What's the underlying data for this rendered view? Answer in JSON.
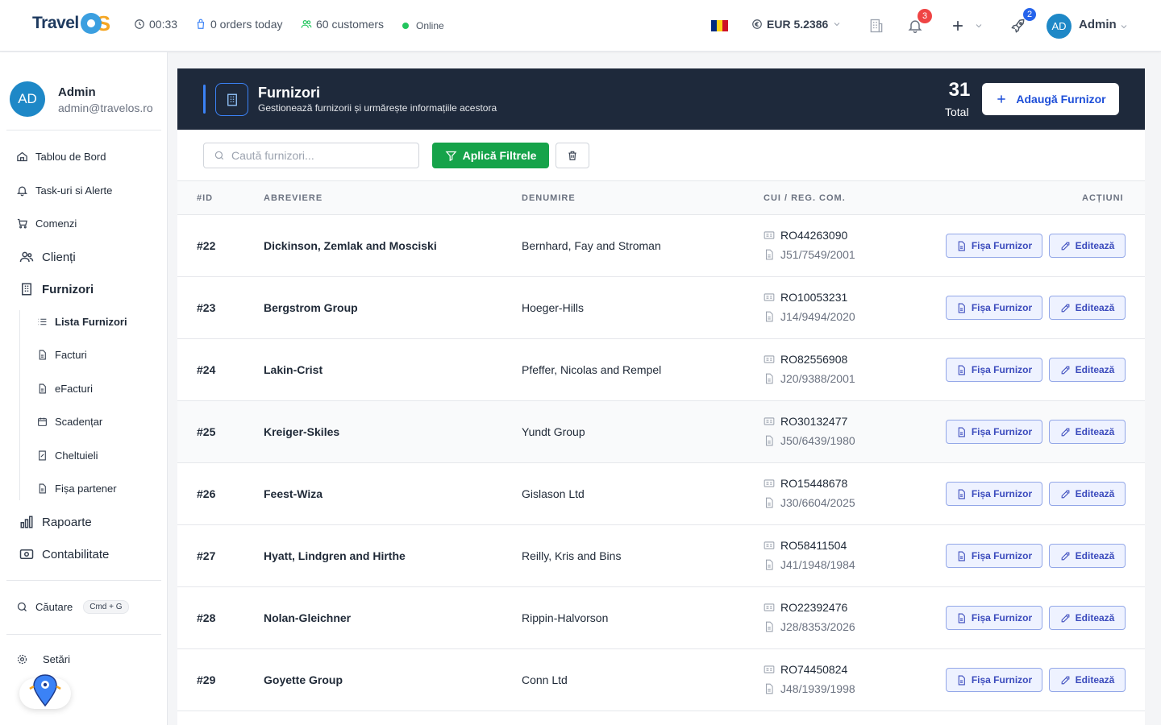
{
  "topbar": {
    "logo_text": "Travel",
    "logo_os": "OS",
    "timer": "00:33",
    "orders": "0 orders today",
    "customers": "60 customers",
    "status": "Online",
    "currency": "EUR 5.2386",
    "notifications_count": "3",
    "rocket_count": "2",
    "avatar_initials": "AD",
    "user_name": "Admin"
  },
  "sidebar": {
    "user": {
      "initials": "AD",
      "name": "Admin",
      "email": "admin@travelos.ro"
    },
    "items": [
      {
        "label": "Tablou de Bord",
        "icon": "home-icon"
      },
      {
        "label": "Task-uri si Alerte",
        "icon": "bell-icon"
      },
      {
        "label": "Comenzi",
        "icon": "cart-icon"
      },
      {
        "label": "Clienți",
        "icon": "users-icon"
      },
      {
        "label": "Furnizori",
        "icon": "building-icon"
      },
      {
        "label": "Rapoarte",
        "icon": "chart-icon"
      },
      {
        "label": "Contabilitate",
        "icon": "money-icon"
      }
    ],
    "subitems": [
      {
        "label": "Lista Furnizori",
        "icon": "list-icon"
      },
      {
        "label": "Facturi",
        "icon": "file-icon"
      },
      {
        "label": "eFacturi",
        "icon": "file-icon"
      },
      {
        "label": "Scadențar",
        "icon": "calendar-icon"
      },
      {
        "label": "Cheltuieli",
        "icon": "receipt-icon"
      },
      {
        "label": "Fișa partener",
        "icon": "file-icon"
      }
    ],
    "search_label": "Căutare",
    "search_shortcut": "Cmd + G",
    "settings_label": "Setări"
  },
  "header": {
    "title": "Furnizori",
    "subtitle": "Gestionează furnizorii și urmărește informațiile acestora",
    "total_count": "31",
    "total_label": "Total",
    "add_button": "Adaugă Furnizor"
  },
  "filters": {
    "search_placeholder": "Caută furnizori...",
    "apply_label": "Aplică Filtrele"
  },
  "table": {
    "columns": [
      "#ID",
      "ABREVIERE",
      "DENUMIRE",
      "CUI / REG. COM.",
      "ACȚIUNI"
    ],
    "fisa_label": "Fișa Furnizor",
    "edit_label": "Editează",
    "rows": [
      {
        "id": "#22",
        "abr": "Dickinson, Zemlak and Mosciski",
        "den": "Bernhard, Fay and Stroman",
        "cui": "RO44263090",
        "reg": "J51/7549/2001"
      },
      {
        "id": "#23",
        "abr": "Bergstrom Group",
        "den": "Hoeger-Hills",
        "cui": "RO10053231",
        "reg": "J14/9494/2020"
      },
      {
        "id": "#24",
        "abr": "Lakin-Crist",
        "den": "Pfeffer, Nicolas and Rempel",
        "cui": "RO82556908",
        "reg": "J20/9388/2001"
      },
      {
        "id": "#25",
        "abr": "Kreiger-Skiles",
        "den": "Yundt Group",
        "cui": "RO30132477",
        "reg": "J50/6439/1980"
      },
      {
        "id": "#26",
        "abr": "Feest-Wiza",
        "den": "Gislason Ltd",
        "cui": "RO15448678",
        "reg": "J30/6604/2025"
      },
      {
        "id": "#27",
        "abr": "Hyatt, Lindgren and Hirthe",
        "den": "Reilly, Kris and Bins",
        "cui": "RO58411504",
        "reg": "J41/1948/1984"
      },
      {
        "id": "#28",
        "abr": "Nolan-Gleichner",
        "den": "Rippin-Halvorson",
        "cui": "RO22392476",
        "reg": "J28/8353/2026"
      },
      {
        "id": "#29",
        "abr": "Goyette Group",
        "den": "Conn Ltd",
        "cui": "RO74450824",
        "reg": "J48/1939/1998"
      }
    ]
  },
  "colors": {
    "accent": "#3b82f6",
    "hero_bg": "#1e293b",
    "success": "#16a34a",
    "danger": "#ef4444",
    "badge_blue": "#2563eb"
  }
}
